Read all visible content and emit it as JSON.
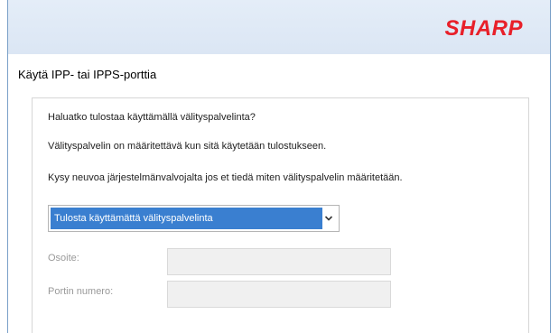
{
  "header": {
    "logo": "SHARP",
    "brand_color": "#e8202a"
  },
  "page": {
    "title": "Käytä IPP- tai IPPS-porttia"
  },
  "content": {
    "question": "Haluatko tulostaa käyttämällä välityspalvelinta?",
    "info": "Välityspalvelin on määritettävä kun sitä käytetään tulostukseen.",
    "advice": "Kysy neuvoa järjestelmänvalvojalta jos et tiedä miten välityspalvelin määritetään."
  },
  "proxy_select": {
    "selected": "Tulosta käyttämättä välityspalvelinta",
    "highlight_color": "#3a7fd0",
    "arrow_icon": "chevron-down-icon"
  },
  "fields": {
    "address_label": "Osoite:",
    "address_value": "",
    "port_label": "Portin numero:",
    "port_value": ""
  }
}
